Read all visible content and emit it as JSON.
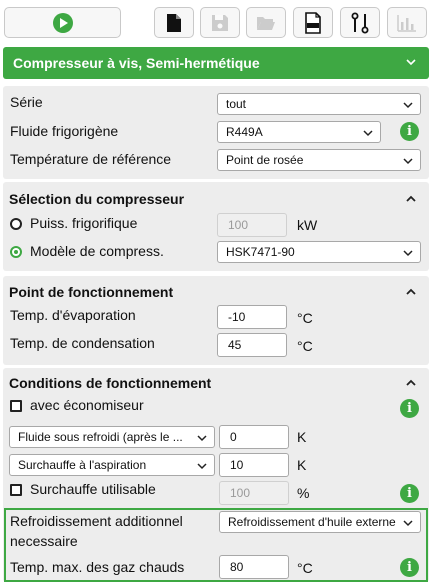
{
  "toolbar": {
    "buttons": [
      {
        "icon": "play-icon",
        "enabled": true
      },
      {
        "icon": "new-document-icon",
        "enabled": true
      },
      {
        "icon": "save-icon",
        "enabled": false
      },
      {
        "icon": "open-folder-icon",
        "enabled": false
      },
      {
        "icon": "pdf-icon",
        "label": "PDF",
        "enabled": true
      },
      {
        "icon": "compare-icon",
        "enabled": true
      },
      {
        "icon": "bar-chart-icon",
        "enabled": false
      }
    ]
  },
  "compressor_type": "Compresseur à vis, Semi-hermétique",
  "general": {
    "series_label": "Série",
    "series_value": "tout",
    "refrigerant_label": "Fluide frigorigène",
    "refrigerant_value": "R449A",
    "ref_temp_label": "Température de référence",
    "ref_temp_value": "Point de rosée"
  },
  "selection": {
    "title": "Sélection du compresseur",
    "capacity_label": "Puiss. frigorifique",
    "capacity_value": "100",
    "capacity_unit": "kW",
    "model_label": "Modèle de compress.",
    "model_value": "HSK7471-90",
    "selected_option": "model"
  },
  "operating_point": {
    "title": "Point de fonctionnement",
    "evap_label": "Temp. d'évaporation",
    "evap_value": "-10",
    "evap_unit": "°C",
    "cond_label": "Temp. de condensation",
    "cond_value": "45",
    "cond_unit": "°C"
  },
  "conditions": {
    "title": "Conditions de fonctionnement",
    "economizer_label": "avec économiseur",
    "subcool_select": "Fluide sous refroidi (après le ...",
    "subcool_value": "0",
    "subcool_unit": "K",
    "superheat_select": "Surchauffe à l'aspiration",
    "superheat_value": "10",
    "superheat_unit": "K",
    "useful_superheat_label": "Surchauffe utilisable",
    "useful_superheat_value": "100",
    "useful_superheat_unit": "%",
    "add_cooling_label_line1": "Refroidissement additionnel",
    "add_cooling_label_line2": "necessaire",
    "add_cooling_value": "Refroidissement d'huile externe",
    "max_discharge_label": "Temp. max. des gaz chauds",
    "max_discharge_value": "80",
    "max_discharge_unit": "°C"
  },
  "colors": {
    "accent": "#3ea843",
    "panel": "#ededed"
  }
}
